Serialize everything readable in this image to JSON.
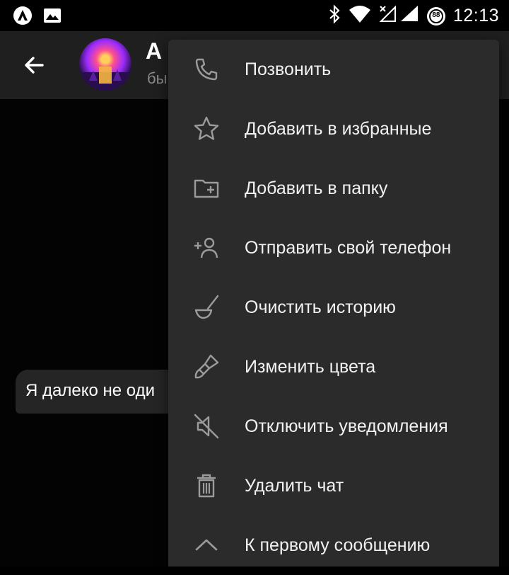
{
  "status_bar": {
    "time": "12:13",
    "badge_count": "88",
    "icons": [
      "app-icon",
      "image-icon",
      "bluetooth-icon",
      "wifi-icon",
      "signal-icon",
      "badge-icon"
    ]
  },
  "header": {
    "title": "A",
    "subtitle": "бы"
  },
  "chat": {
    "message_text": "Я далеко не оди"
  },
  "menu": {
    "items": [
      {
        "label": "Позвонить",
        "icon": "phone-icon"
      },
      {
        "label": "Добавить в избранные",
        "icon": "star-icon"
      },
      {
        "label": "Добавить в папку",
        "icon": "folder-add-icon"
      },
      {
        "label": "Отправить свой телефон",
        "icon": "add-person-icon"
      },
      {
        "label": "Очистить историю",
        "icon": "broom-icon"
      },
      {
        "label": "Изменить цвета",
        "icon": "brush-icon"
      },
      {
        "label": "Отключить уведомления",
        "icon": "mute-icon"
      },
      {
        "label": "Удалить чат",
        "icon": "trash-icon"
      },
      {
        "label": "К первому сообщению",
        "icon": "chevron-up-icon"
      }
    ]
  },
  "colors": {
    "menu_bg": "#2b2b2b",
    "appbar_bg": "#1f1f1f",
    "icon_gray": "#9b9b9b",
    "text": "#f2f2f2"
  }
}
